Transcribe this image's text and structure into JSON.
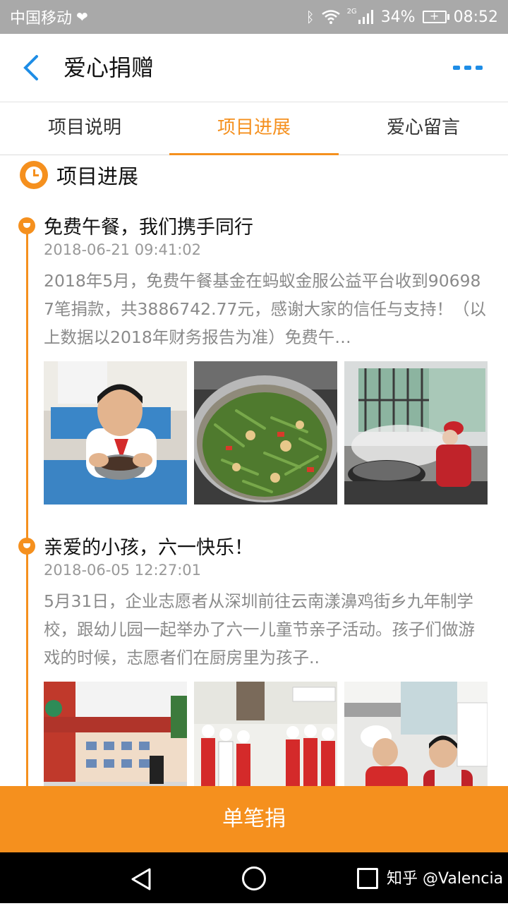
{
  "status_bar": {
    "carrier": "中国移动",
    "network": "2G",
    "battery": "34%",
    "time": "08:52",
    "icons": [
      "heart-pulse-icon",
      "bluetooth-icon",
      "wifi-icon",
      "signal-icon",
      "battery-charging-icon"
    ]
  },
  "header": {
    "title": "爱心捐赠",
    "back_icon": "chevron-left-icon",
    "more_icon": "more-dots-icon"
  },
  "tabs": [
    {
      "label": "项目说明",
      "active": false
    },
    {
      "label": "项目进展",
      "active": true
    },
    {
      "label": "爱心留言",
      "active": false
    }
  ],
  "section": {
    "title": "项目进展",
    "icon": "clock-icon"
  },
  "entries": [
    {
      "title": "免费午餐，我们携手同行",
      "date": "2018-06-21 09:41:02",
      "body": "2018年5月，免费午餐基金在蚂蚁金服公益平台收到906987笔捐款，共3886742.77元，感谢大家的信任与支持！（以上数据以2018年财务报告为准）免费午…",
      "photos": [
        "boy eating lunch",
        "stir-fried green beans in pot",
        "cook at steaming wok"
      ]
    },
    {
      "title": "亲爱的小孩，六一快乐！",
      "date": "2018-06-05 12:27:01",
      "body": "5月31日，企业志愿者从深圳前往云南漾濞鸡街乡九年制学校，跟幼儿园一起举办了六一儿童节亲子活动。孩子们做游戏的时候，志愿者们在厨房里为孩子..",
      "photos": [
        "school gate",
        "volunteers in chef hats",
        "volunteers in kitchen"
      ]
    }
  ],
  "donate_button": "单笔捐",
  "nav_bar": {
    "watermark": "知乎 @Valencia"
  },
  "colors": {
    "accent": "#f5901e",
    "link_blue": "#1e8de6",
    "status_gray": "#a9a9a9"
  }
}
